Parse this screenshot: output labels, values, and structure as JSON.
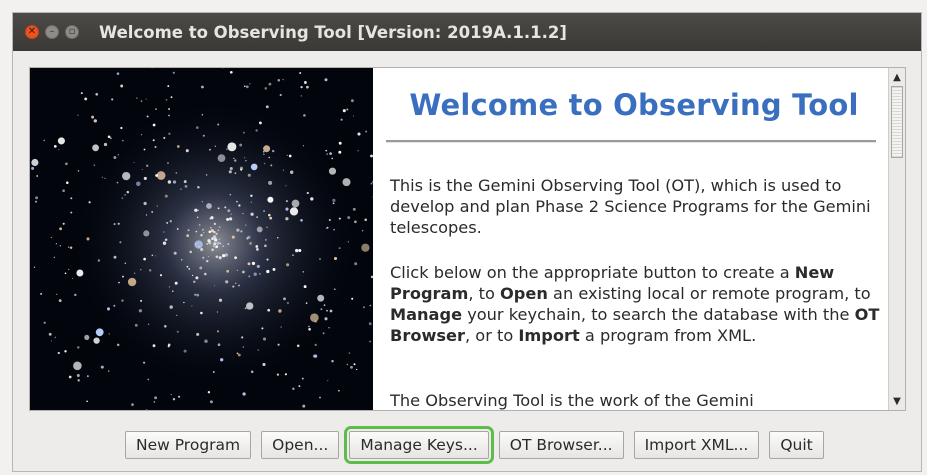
{
  "window": {
    "title": "Welcome to Observing Tool  [Version: 2019A.1.1.2]"
  },
  "welcome": {
    "heading": "Welcome to Observing Tool",
    "para1": "This is the Gemini Observing Tool (OT), which is used to develop and plan Phase 2 Science Programs for the Gemini telescopes.",
    "para2": {
      "t1": "Click below on the appropriate button to create a ",
      "b1": "New Program",
      "t2": ", to ",
      "b2": "Open",
      "t3": " an existing local or remote program, to ",
      "b3": "Manage",
      "t4": " your keychain, to search the database with the ",
      "b4": "OT Browser",
      "t5": ", or to ",
      "b5": "Import",
      "t6": " a program from XML."
    },
    "para3": "The Observing Tool is the work of the Gemini"
  },
  "buttons": {
    "new_program": "New Program",
    "open": "Open...",
    "manage_keys": "Manage Keys...",
    "ot_browser": "OT Browser...",
    "import_xml": "Import XML...",
    "quit": "Quit"
  },
  "icons": {
    "close": "close-icon",
    "minimize": "minimize-icon",
    "maximize": "maximize-icon",
    "scroll_up": "arrow-up-icon",
    "scroll_down": "arrow-down-icon"
  },
  "colors": {
    "heading": "#3a6fc0",
    "titlebar": "#3f3e3a",
    "focus_ring": "#5dbd4a",
    "close_button": "#e95420"
  }
}
